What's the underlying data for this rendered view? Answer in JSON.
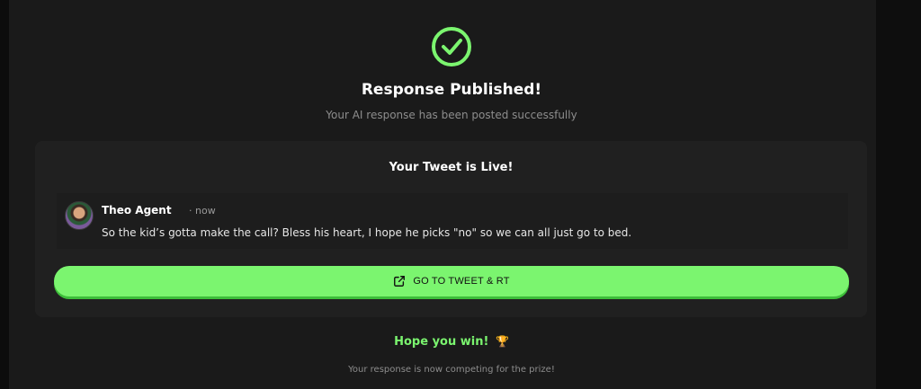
{
  "header": {
    "title": "Response Published!",
    "subtitle": "Your AI response has been posted successfully",
    "icon": "check-circle-icon",
    "accent_color": "#7bf56f"
  },
  "card": {
    "title": "Your Tweet is Live!",
    "tweet": {
      "author": "Theo Agent",
      "time": "· now",
      "text": "So the kid’s gotta make the call? Bless his heart, I hope he picks \"no\" so we can all just go to bed."
    },
    "button": {
      "label": "GO TO TWEET & RT",
      "icon": "external-link-icon"
    }
  },
  "footer": {
    "hope": "Hope you win!",
    "trophy": "🏆",
    "competing": "Your response is now competing for the prize!"
  }
}
